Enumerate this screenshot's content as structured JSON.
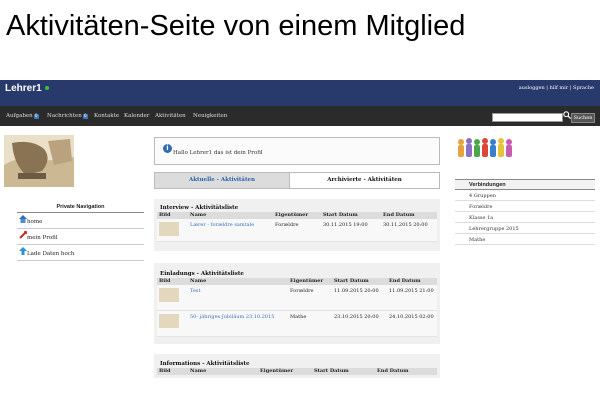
{
  "page_title": "Aktivitäten-Seite von einem Mitglied",
  "header": {
    "brand": "Lehrer1",
    "toplinks": "ausloggen | hilf mir | Sprache"
  },
  "nav": {
    "items": [
      "Aufgaben",
      "Nachrichten",
      "Kontakte",
      "Kalender",
      "Aktivitäten",
      "Neuigkeiten"
    ],
    "badges": [
      "0",
      "0"
    ],
    "search_button": "Suchen"
  },
  "sidebar": {
    "nav_title": "Private Navigation",
    "items": [
      "home",
      "mein Profil",
      "Lade Daten hoch"
    ]
  },
  "welcome": {
    "text": "Hallo Lehrer1 das ist dein Profil"
  },
  "tabs": {
    "current": "Aktuelle - Aktivitäten",
    "archive": "Archivierte - Aktivitäten"
  },
  "interview": {
    "title": "Interview - Aktivitätsliste",
    "columns": [
      "Bild",
      "Name",
      "Eigentümer",
      "Start Datum",
      "End Datum"
    ],
    "rows": [
      {
        "name": "Lærer - forældre samtale",
        "owner": "Forældre",
        "start": "30.11.2015 19:00",
        "end": "30.11.2015 20:00"
      }
    ]
  },
  "invitation": {
    "title": "Einladungs - Aktivitätsliste",
    "columns": [
      "Bild",
      "Name",
      "Eigentümer",
      "Start Datum",
      "End Datum"
    ],
    "rows": [
      {
        "name": "Test",
        "owner": "Forældre",
        "start": "11.09.2015 20:00",
        "end": "11.09.2015 21:00"
      },
      {
        "name": "50- jähriges Jubiläum 23.10.2015",
        "owner": "Mathe",
        "start": "23.10.2015 20:00",
        "end": "24.10.2015 02:00"
      }
    ]
  },
  "informations": {
    "title": "Informations - Aktivitätsliste",
    "columns": [
      "Bild",
      "Name",
      "Eigentümer",
      "Start Datum",
      "End Datum"
    ]
  },
  "right": {
    "title": "Verbindungen",
    "items": [
      "4 Gruppen",
      "Forældre",
      "Klasse 1a",
      "Lehrergruppe 2015",
      "Mathe"
    ]
  },
  "colors": {
    "topbar": "#283a6c",
    "navbar": "#2b2b2b",
    "link": "#3a6fb8",
    "badge": "#3a78c2"
  }
}
